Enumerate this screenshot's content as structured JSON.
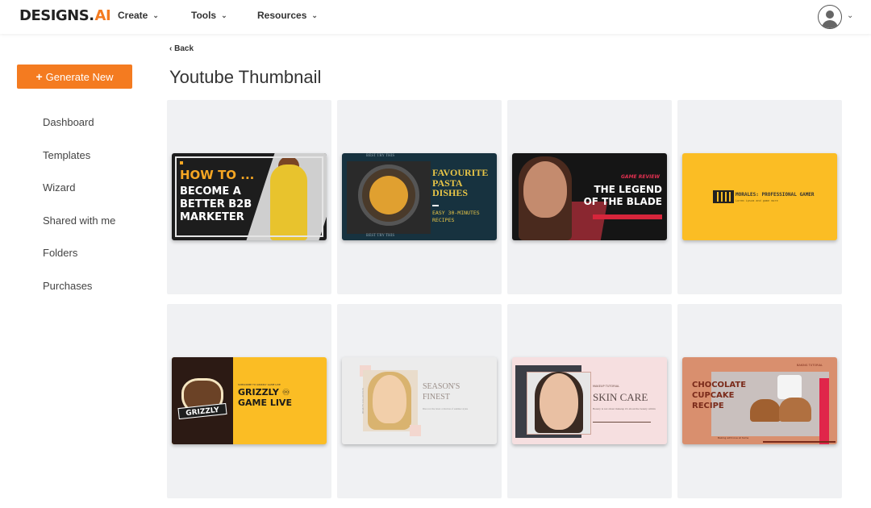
{
  "header": {
    "logo_main": "DESIGNS.",
    "logo_ai": "AI",
    "nav": [
      {
        "label": "Create"
      },
      {
        "label": "Tools"
      },
      {
        "label": "Resources"
      }
    ]
  },
  "sidebar": {
    "generate_label": "Generate New",
    "items": [
      {
        "label": "Dashboard"
      },
      {
        "label": "Templates"
      },
      {
        "label": "Wizard"
      },
      {
        "label": "Shared with me"
      },
      {
        "label": "Folders"
      },
      {
        "label": "Purchases"
      }
    ]
  },
  "main": {
    "back_label": "Back",
    "title": "Youtube Thumbnail"
  },
  "templates": [
    {
      "how_to": "HOW TO ...",
      "lines": [
        "BECOME A",
        "BETTER B2B",
        "MARKETER"
      ]
    },
    {
      "header": "BEST TRY THIS",
      "title_lines": [
        "FAVOURITE",
        "PASTA",
        "DISHES"
      ],
      "sub_lines": [
        "EASY 30-MINUTES",
        "RECIPES"
      ],
      "footer": "BEST TRY THIS"
    },
    {
      "tag": "GAME REVIEW",
      "title_lines": [
        "THE LEGEND",
        "OF THE BLADE"
      ]
    },
    {
      "name": "MORALES: PROFESSIONAL GAMER",
      "sub": "Lorem ipsum and game more"
    },
    {
      "badge": "GRIZZLY",
      "title_lines": [
        "GRIZZLY ♾",
        "GAME LIVE"
      ],
      "small": "SUBSCRIBE TO GRIZZLY GAME LIVE"
    },
    {
      "title_lines": [
        "SEASON'S",
        "FINEST"
      ],
      "desc": "Discover the latest collection of summer styles",
      "vertical": "BEAUTY COLLECTION"
    },
    {
      "tag": "MAKEUP TUTORIAL",
      "title": "SKIN CARE",
      "desc": "Beauty is not about makeup it's about the beauty within"
    },
    {
      "tag": "BAKING TUTORIAL",
      "title_lines": [
        "CHOCOLATE",
        "CUPCAKE",
        "RECIPE"
      ],
      "footer": "Baking with love at home"
    }
  ]
}
